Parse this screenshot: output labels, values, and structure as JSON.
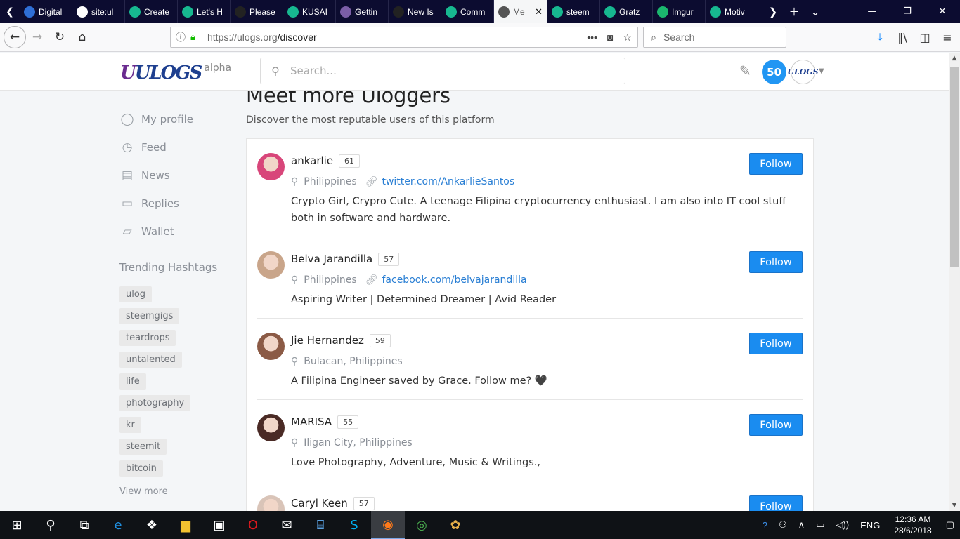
{
  "browser": {
    "tabs": [
      {
        "label": "Digital",
        "favicon": "#2f6fd6",
        "icon": "steem-icon"
      },
      {
        "label": "site:ul",
        "favicon": "#ffffff",
        "icon": "google-icon"
      },
      {
        "label": "Create",
        "favicon": "#17b890",
        "icon": "steemit-icon"
      },
      {
        "label": "Let's H",
        "favicon": "#17b890",
        "icon": "steemit-icon"
      },
      {
        "label": "Please",
        "favicon": "#222222",
        "icon": "github-icon"
      },
      {
        "label": "KUSAI",
        "favicon": "#17b890",
        "icon": "steemit-icon"
      },
      {
        "label": "Gettin",
        "favicon": "#7b5ea7",
        "icon": "hackmd-icon"
      },
      {
        "label": "New Is",
        "favicon": "#222222",
        "icon": "github-icon"
      },
      {
        "label": "Comm",
        "favicon": "#17b890",
        "icon": "steemit-icon"
      },
      {
        "label": "Me",
        "favicon": "#555555",
        "icon": "bolt-icon",
        "active": true
      },
      {
        "label": "steem",
        "favicon": "#17b890",
        "icon": "steemit-icon"
      },
      {
        "label": "Gratz",
        "favicon": "#17b890",
        "icon": "steemit-icon"
      },
      {
        "label": "Imgur",
        "favicon": "#1bb76e",
        "icon": "imgur-icon"
      },
      {
        "label": "Motiv",
        "favicon": "#17b890",
        "icon": "steemit-icon"
      }
    ],
    "url_host": "https://ulogs.org",
    "url_path": "/discover",
    "search_placeholder": "Search"
  },
  "site": {
    "logo_text": "ULOGS",
    "logo_badge": "alpha",
    "search_placeholder": "Search...",
    "voting_power": "50",
    "avatar_text": "ULOGS"
  },
  "sidebar": {
    "nav": [
      {
        "label": "My profile",
        "icon": "user-circle-icon",
        "glyph": "◯"
      },
      {
        "label": "Feed",
        "icon": "clock-icon",
        "glyph": "◷"
      },
      {
        "label": "News",
        "icon": "newspaper-icon",
        "glyph": "▤"
      },
      {
        "label": "Replies",
        "icon": "comment-icon",
        "glyph": "▭"
      },
      {
        "label": "Wallet",
        "icon": "wallet-icon",
        "glyph": "▱"
      }
    ],
    "trending_heading": "Trending Hashtags",
    "hashtags": [
      "ulog",
      "steemgigs",
      "teardrops",
      "untalented",
      "life",
      "photography",
      "kr",
      "steemit",
      "bitcoin"
    ],
    "view_more": "View more"
  },
  "main": {
    "title": "Meet more Uloggers",
    "subtitle": "Discover the most reputable users of this platform",
    "follow_label": "Follow",
    "users": [
      {
        "name": "ankarlie",
        "rep": "61",
        "location": "Philippines",
        "link": "twitter.com/AnkarlieSantos",
        "bio": "Crypto Girl, Crypro Cute. A teenage Filipina cryptocurrency enthusiast. I am also into IT cool stuff both in software and hardware.",
        "avatar_color": "#d8467a"
      },
      {
        "name": "Belva Jarandilla",
        "rep": "57",
        "location": "Philippines",
        "link": "facebook.com/belvajarandilla",
        "bio": "Aspiring Writer | Determined Dreamer | Avid Reader",
        "avatar_color": "#c9a58a"
      },
      {
        "name": "Jie Hernandez",
        "rep": "59",
        "location": "Bulacan, Philippines",
        "link": "",
        "bio": "A Filipina Engineer saved by Grace. Follow me? 🖤",
        "avatar_color": "#8b5a45"
      },
      {
        "name": "MARISA",
        "rep": "55",
        "location": "Iligan City, Philippines",
        "link": "",
        "bio": "Love Photography, Adventure, Music & Writings.,",
        "avatar_color": "#4a2a25"
      },
      {
        "name": "Caryl Keen",
        "rep": "57",
        "location": "Philippines",
        "link": "",
        "bio": "",
        "avatar_color": "#d9c4b8"
      }
    ]
  },
  "taskbar": {
    "lang": "ENG",
    "time": "12:36 AM",
    "date": "28/6/2018"
  }
}
